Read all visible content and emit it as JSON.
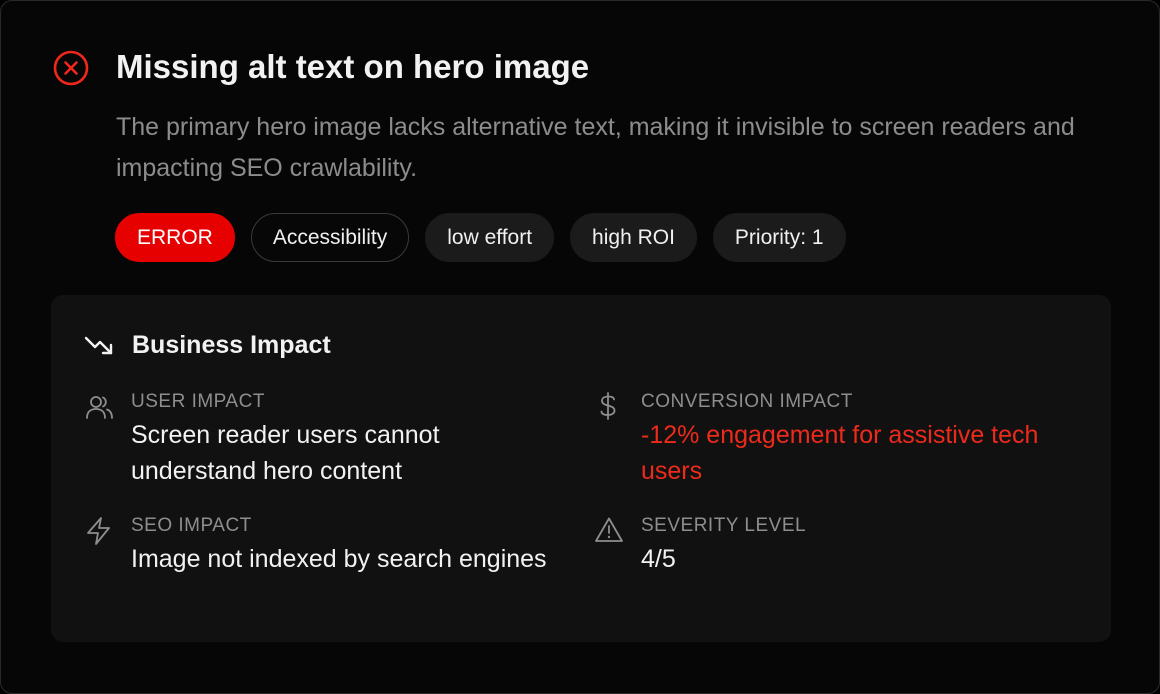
{
  "issue": {
    "status_icon": "error-x-circle-icon",
    "title": "Missing alt text on hero image",
    "description": "The primary hero image lacks alternative text, making it invisible to screen readers and impacting SEO crawlability.",
    "tags": [
      {
        "label": "ERROR",
        "style": "error"
      },
      {
        "label": "Accessibility",
        "style": "outline"
      },
      {
        "label": "low effort",
        "style": "filled"
      },
      {
        "label": "high ROI",
        "style": "filled"
      },
      {
        "label": "Priority: 1",
        "style": "filled"
      }
    ]
  },
  "business_impact": {
    "icon": "trending-down-icon",
    "title": "Business Impact",
    "metrics": {
      "user": {
        "icon": "users-icon",
        "label": "USER IMPACT",
        "value": "Screen reader users cannot understand hero content"
      },
      "conversion": {
        "icon": "dollar-icon",
        "label": "CONVERSION IMPACT",
        "value": "-12% engagement for assistive tech users"
      },
      "seo": {
        "icon": "lightning-icon",
        "label": "SEO IMPACT",
        "value": "Image not indexed by search engines"
      },
      "severity": {
        "icon": "warning-triangle-icon",
        "label": "SEVERITY LEVEL",
        "value": "4/5"
      }
    }
  },
  "colors": {
    "error": "#e60000",
    "negative_text": "#ee2a1b",
    "background": "#060606",
    "panel": "#111111"
  }
}
